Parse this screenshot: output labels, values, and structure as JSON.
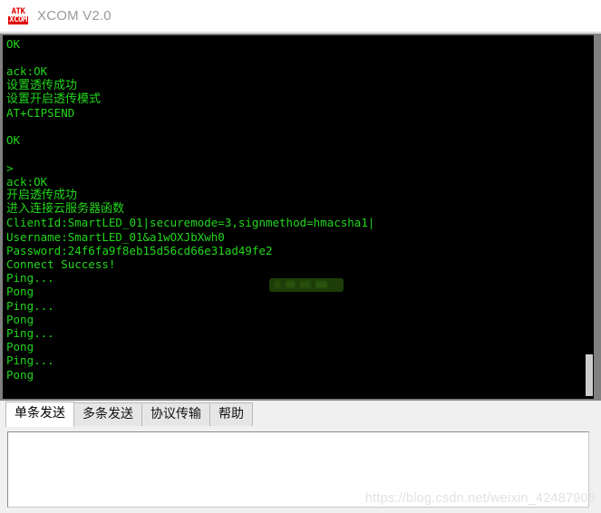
{
  "window": {
    "title": "XCOM V2.0",
    "logo_top": "ATK",
    "logo_bottom": "XCOM",
    "logo_color": "#e00000",
    "title_color": "#9a9a9a"
  },
  "terminal": {
    "background": "#000000",
    "text_color": "#22d61c",
    "lines": [
      "OK",
      "",
      "ack:OK",
      "设置透传成功",
      "设置开启透传模式",
      "AT+CIPSEND",
      "",
      "OK",
      "",
      ">",
      "ack:OK",
      "开启透传成功",
      "进入连接云服务器函数",
      "ClientId:SmartLED_01|securemode=3,signmethod=hmacsha1|",
      "Username:SmartLED_01&a1wOXJbXwh0",
      "Password:24f6fa9f8eb15d56cd66e31ad49fe2",
      "Connect Success!",
      "Ping...",
      "Pong",
      "Ping...",
      "Pong",
      "Ping...",
      "Pong",
      "Ping...",
      "Pong"
    ],
    "redaction_note": "redacted-password-tail",
    "scrollbar_thumb_color": "#cdcdcd"
  },
  "tabs": [
    {
      "label": "单条发送",
      "active": true
    },
    {
      "label": "多条发送",
      "active": false
    },
    {
      "label": "协议传输",
      "active": false
    },
    {
      "label": "帮助",
      "active": false
    }
  ],
  "send": {
    "value": "",
    "placeholder": ""
  },
  "watermark": {
    "text": "https://blog.csdn.net/weixin_42487906",
    "color": "#e2e2e2"
  }
}
